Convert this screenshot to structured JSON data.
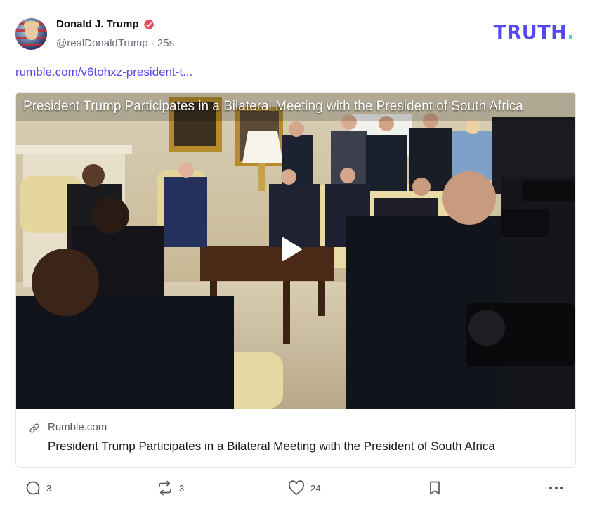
{
  "post": {
    "display_name": "Donald J. Trump",
    "handle": "@realDonaldTrump",
    "separator": "·",
    "time_ago": "25s",
    "link_text": "rumble.com/v6tohxz-president-t..."
  },
  "brand": {
    "text": "TRUTH",
    "dot": ".",
    "color": "#5448ee",
    "dot_color": "#4dd9c4"
  },
  "verified_badge": {
    "icon": "verified-badge-icon",
    "color": "#e24b57"
  },
  "video": {
    "title": "President Trump Participates in a Bilateral Meeting with the President of South Africa",
    "play_icon": "play-icon"
  },
  "link_card": {
    "domain": "Rumble.com",
    "title": "President Trump Participates in a Bilateral Meeting with the President of South Africa",
    "icon": "link-icon"
  },
  "actions": {
    "reply": {
      "icon": "comment-icon",
      "count": "3"
    },
    "retruth": {
      "icon": "repost-icon",
      "count": "3"
    },
    "like": {
      "icon": "heart-icon",
      "count": "24"
    },
    "bookmark": {
      "icon": "bookmark-icon"
    },
    "more": {
      "icon": "more-horizontal-icon"
    }
  }
}
